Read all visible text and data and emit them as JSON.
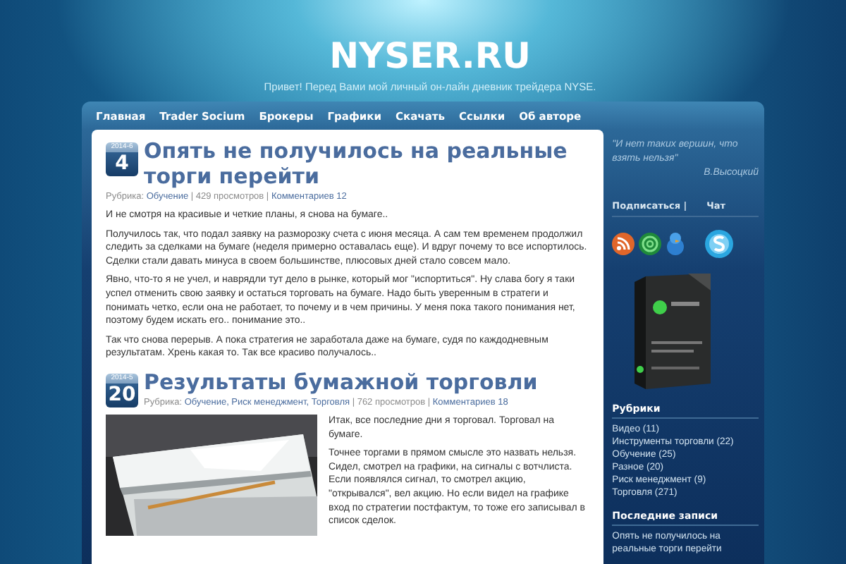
{
  "site": {
    "title": "NYSER.RU",
    "tagline": "Привет! Перед Вами мой личный он-лайн дневник трейдера NYSE."
  },
  "nav": [
    {
      "label": "Главная"
    },
    {
      "label": "Trader Socium"
    },
    {
      "label": "Брокеры"
    },
    {
      "label": "Графики"
    },
    {
      "label": "Скачать"
    },
    {
      "label": "Ссылки"
    },
    {
      "label": "Об авторе"
    }
  ],
  "posts": [
    {
      "date_year": "2014-6",
      "date_day": "4",
      "title": "Опять не получилось на реальные торги перейти",
      "meta": [
        {
          "kind": "plain",
          "text": "Рубрика: "
        },
        {
          "kind": "link",
          "text": "Обучение"
        },
        {
          "kind": "plain",
          "text": " | 429 просмотров | "
        },
        {
          "kind": "link",
          "text": "Комментариев 12"
        }
      ],
      "kind": "text",
      "paragraphs": [
        "И не смотря на красивые и четкие планы, я снова на бумаге..",
        "Получилось так, что подал заявку на разморозку счета с июня месяца. А сам тем временем продолжил следить за сделками на бумаге (неделя примерно оставалась еще). И вдруг почему то все испортилось. Сделки стали давать минуса в своем большинстве, плюсовых дней стало совсем мало.",
        "Явно, что-то я не учел, и наврядли тут дело в рынке, который мог \"испортиться\". Ну слава богу я таки успел отменить свою  заявку и остаться торговать на бумаге. Надо быть уверенным в стратеги и понимать четко, если она не работает, то почему и в чем причины. У меня пока такого понимания нет, поэтому будем искать его.. понимание это..",
        "Так что снова перерыв. А пока стратегия не заработала даже на бумаге, судя по каждодневным результатам. Хрень какая то. Так все красиво получалось.."
      ]
    },
    {
      "date_year": "2014-5",
      "date_day": "20",
      "title": "Результаты бумажной торговли",
      "meta": [
        {
          "kind": "plain",
          "text": "Рубрика: "
        },
        {
          "kind": "link",
          "text": "Обучение, Риск менеджмент, Торговля"
        },
        {
          "kind": "plain",
          "text": " | 762 просмотров | "
        },
        {
          "kind": "link",
          "text": "Комментариев 18"
        }
      ],
      "kind": "picture",
      "paragraphs": [
        "Итак, все последние дни я торговал. Торговал на бумаге.",
        "Точнее торгами в прямом смысле это назвать нельзя. Сидел, смотрел на графики, на сигналы с вотчлиста. Если появлялся сигнал, то смотрел акцию, \"открывался\", вел акцию. Но если видел на графике вход по стратегии постфактум,  то тоже его записывал в список сделок."
      ]
    }
  ],
  "sidebar": {
    "quote": "\"И нет таких вершин, что взять нельзя\"",
    "quote_author": "В.Высоцкий",
    "tabs": [
      {
        "label": "Подписаться |"
      },
      {
        "label": "Чат"
      }
    ],
    "categories": {
      "title": "Рубрики",
      "items": [
        "Видео (11)",
        "Инструменты торговли (22)",
        "Обучение (25)",
        "Разное (20)",
        "Риск менеджмент (9)",
        "Торговля (271)"
      ]
    },
    "recent": {
      "title": "Последние записи",
      "items": [
        "Опять не получилось на реальные торги перейти"
      ]
    }
  }
}
